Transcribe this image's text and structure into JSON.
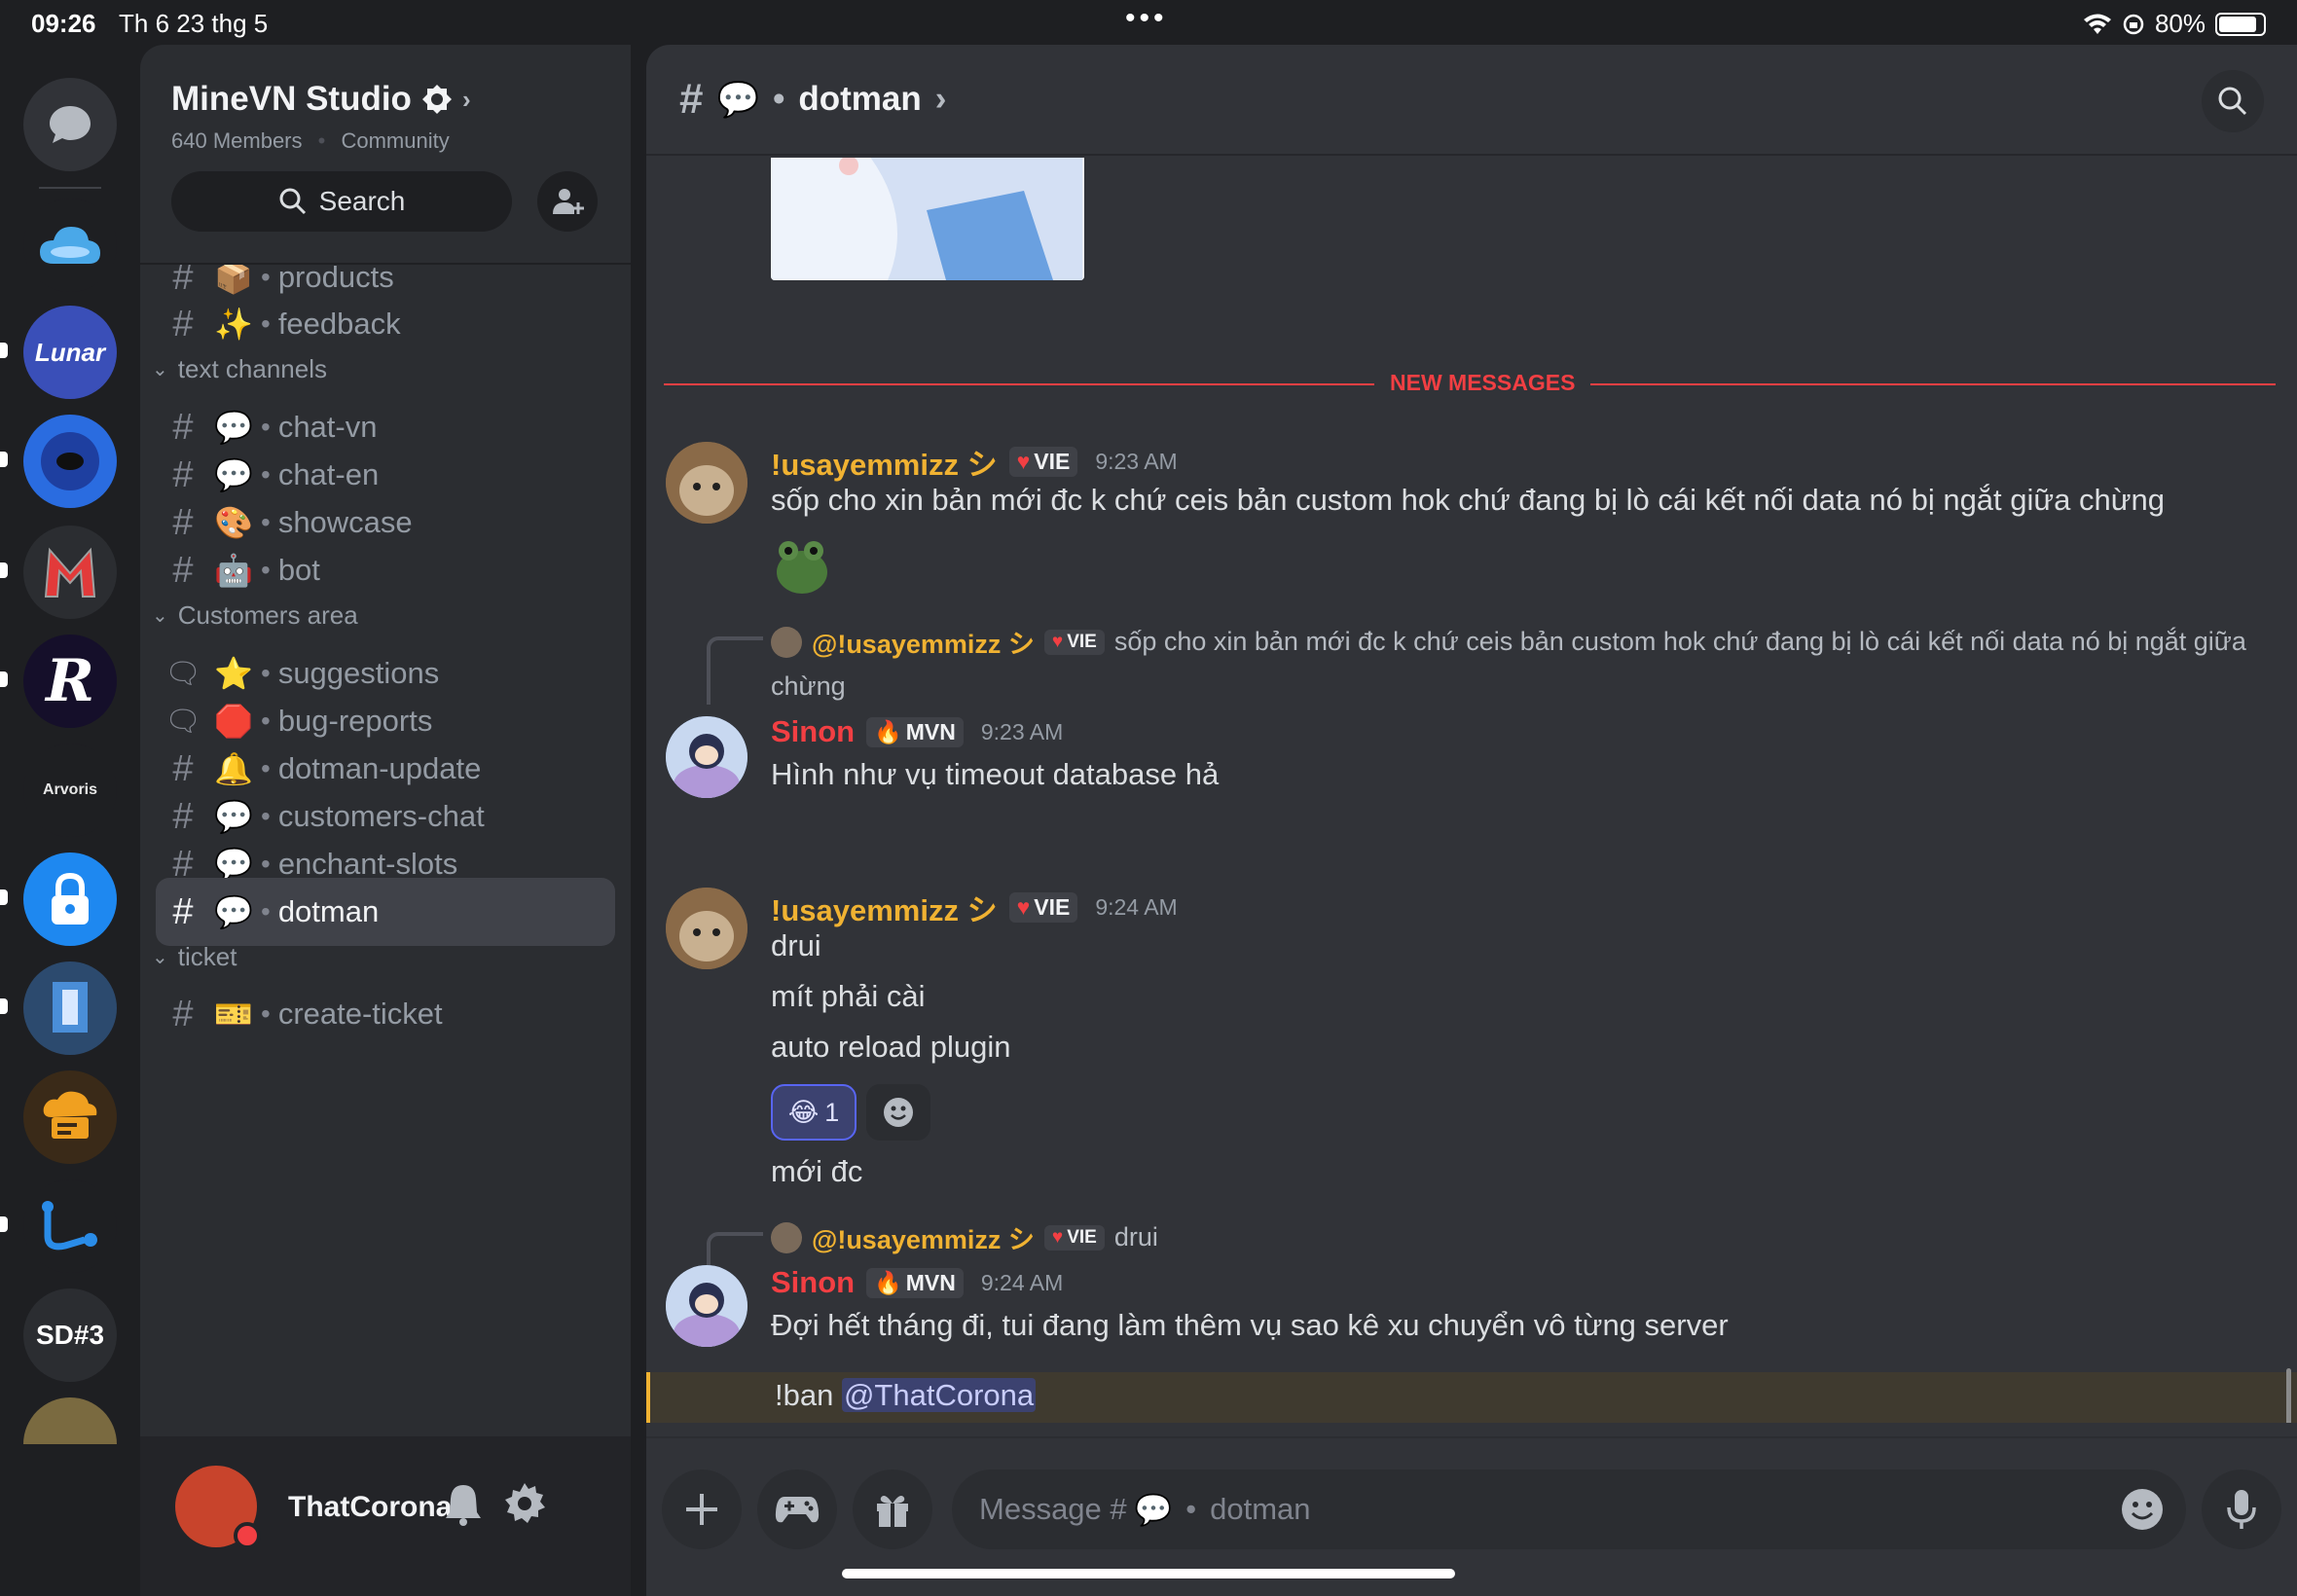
{
  "status": {
    "time": "09:26",
    "date": "Th 6 23 thg 5",
    "battery": "80%"
  },
  "rail": {
    "sd_label": "SD#3",
    "arvoris": "Arvoris"
  },
  "server": {
    "name": "MineVN Studio",
    "members": "640 Members",
    "type": "Community",
    "search_label": "Search"
  },
  "channels": {
    "top": [
      {
        "emoji": "📦",
        "name": "products"
      },
      {
        "emoji": "✨",
        "name": "feedback"
      }
    ],
    "cat_text": "text channels",
    "text": [
      {
        "emoji": "💬",
        "name": "chat-vn"
      },
      {
        "emoji": "💬",
        "name": "chat-en"
      },
      {
        "emoji": "🎨",
        "name": "showcase"
      },
      {
        "emoji": "🤖",
        "name": "bot"
      }
    ],
    "cat_customers": "Customers area",
    "customers": [
      {
        "emoji": "⭐",
        "name": "suggestions"
      },
      {
        "emoji": "🛑",
        "name": "bug-reports"
      },
      {
        "emoji": "🔔",
        "name": "dotman-update"
      },
      {
        "emoji": "💬",
        "name": "customers-chat"
      },
      {
        "emoji": "💬",
        "name": "enchant-slots"
      },
      {
        "emoji": "💬",
        "name": "dotman"
      }
    ],
    "cat_ticket": "ticket",
    "ticket": [
      {
        "emoji": "🎫",
        "name": "create-ticket"
      }
    ]
  },
  "user": {
    "name": "ThatCorona"
  },
  "chat": {
    "channel_emoji": "💬",
    "channel_name": "dotman",
    "new_messages": "NEW MESSAGES",
    "messages": [
      {
        "author": "!usayemmizz シ",
        "tag": "VIE",
        "time": "9:23 AM",
        "lines": [
          "sốp cho xin bản mới đc k chứ ceis bản custom hok chứ đang bị lò cái kết nối data nó bị ngắt giữa chừng"
        ]
      },
      {
        "reply_author": "@!usayemmizz シ",
        "reply_tag": "VIE",
        "reply_text": "sốp cho xin bản mới đc k chứ ceis bản custom hok chứ đang bị lò cái kết nối data nó bị ngắt giữa",
        "reply_text2": "chừng",
        "author": "Sinon",
        "tag": "MVN",
        "time": "9:23 AM",
        "lines": [
          "Hình như vụ timeout database hả"
        ]
      },
      {
        "author": "!usayemmizz シ",
        "tag": "VIE",
        "time": "9:24 AM",
        "lines": [
          "drui",
          "mít phải cài",
          "auto reload plugin",
          "mới đc"
        ],
        "reaction_emoji": "😂",
        "reaction_count": "1"
      },
      {
        "reply_author": "@!usayemmizz シ",
        "reply_tag": "VIE",
        "reply_text": "drui",
        "author": "Sinon",
        "tag": "MVN",
        "time": "9:24 AM",
        "lines": [
          "Đợi hết tháng đi, tui đang làm thêm vụ sao kê xu chuyển vô từng server"
        ],
        "mention_prefix": "!ban ",
        "mention": "@ThatCorona"
      }
    ]
  },
  "composer": {
    "placeholder_prefix": "Message #",
    "placeholder_channel": "dotman"
  },
  "colors": {
    "accent_red": "#f23f43",
    "vie_name": "#f0b232",
    "sinon_name": "#f23f43"
  }
}
